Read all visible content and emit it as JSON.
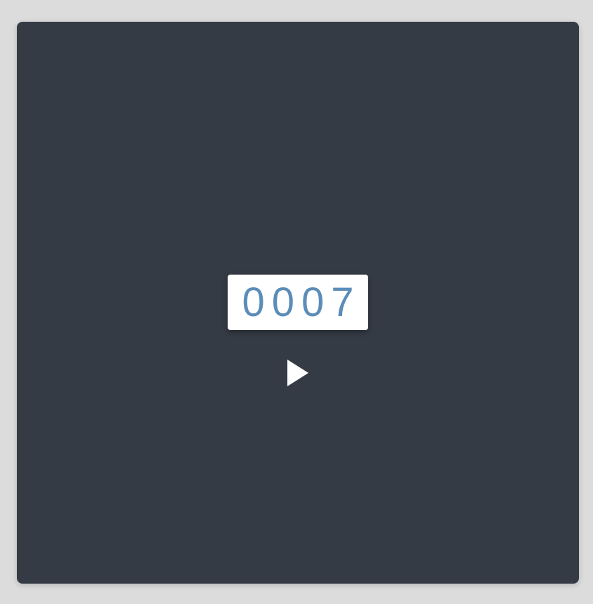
{
  "counter": {
    "value": "0007"
  },
  "controls": {
    "play_icon": "play-icon"
  },
  "colors": {
    "page_background": "#dcdcdc",
    "panel_background": "#353b45",
    "counter_background": "#ffffff",
    "counter_text": "#5b8db8",
    "play_icon": "#ffffff"
  }
}
